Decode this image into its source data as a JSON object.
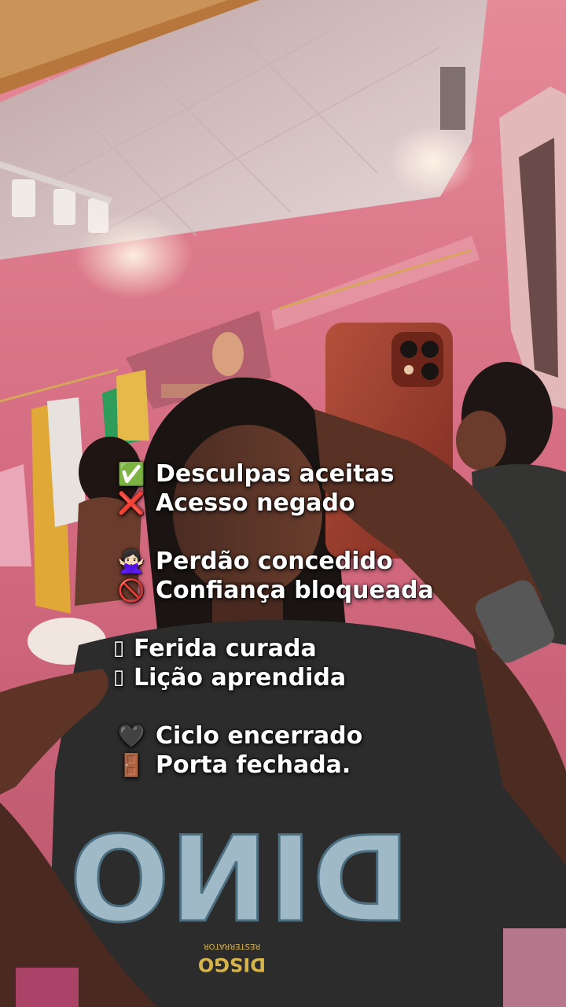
{
  "caption": {
    "groups": [
      {
        "lines": [
          {
            "icon": "✅",
            "icon_name": "check-mark-icon",
            "text": "Desculpas aceitas"
          },
          {
            "icon": "❌",
            "icon_name": "cross-mark-icon",
            "text": "Acesso negado"
          }
        ]
      },
      {
        "lines": [
          {
            "icon": "🙅🏻‍♀️",
            "icon_name": "woman-gesturing-no-icon",
            "text": "Perdão concedido"
          },
          {
            "icon": "🚫",
            "icon_name": "prohibited-icon",
            "text": "Confiança bloqueada"
          }
        ]
      },
      {
        "lines": [
          {
            "icon": "▯",
            "icon_name": "missing-glyph-box-icon",
            "text": "Ferida curada"
          },
          {
            "icon": "▯",
            "icon_name": "missing-glyph-box-icon",
            "text": "Lição aprendida"
          }
        ]
      },
      {
        "lines": [
          {
            "icon": "🖤",
            "icon_name": "dark-sphere-icon",
            "text": "Ciclo encerrado"
          },
          {
            "icon": "🚪",
            "icon_name": "door-icon",
            "text": "Porta fechada."
          }
        ]
      }
    ]
  },
  "shirt_print": {
    "logo_text": "DINO",
    "brand_text": "DISGO",
    "brand_subtext": "RESTERRATOR"
  },
  "colors": {
    "wall_pink": "#d86f86",
    "ceiling": "#d9c9c8",
    "shirt": "#2b2c2b",
    "phone_case": "#9a3a2a",
    "caption_text": "#ffffff"
  }
}
